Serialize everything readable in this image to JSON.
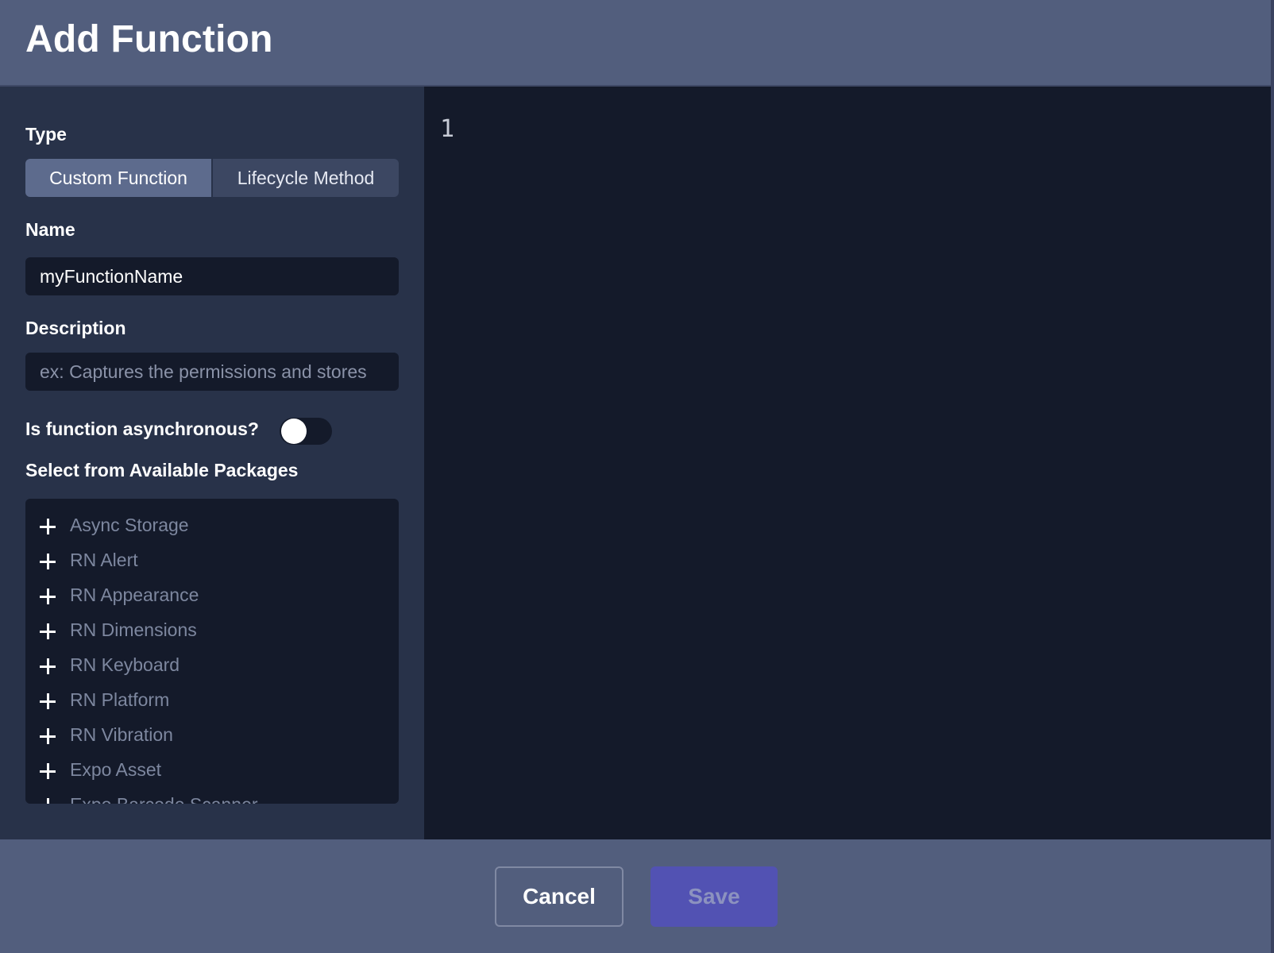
{
  "header": {
    "title": "Add Function"
  },
  "form": {
    "type": {
      "label": "Type",
      "options": [
        "Custom Function",
        "Lifecycle Method"
      ],
      "selected": "Custom Function"
    },
    "name": {
      "label": "Name",
      "value": "myFunctionName"
    },
    "description": {
      "label": "Description",
      "placeholder": "ex: Captures the permissions and stores"
    },
    "async": {
      "label": "Is function asynchronous?",
      "enabled": false
    },
    "packages": {
      "label": "Select from Available Packages",
      "items": [
        "Async Storage",
        "RN Alert",
        "RN Appearance",
        "RN Dimensions",
        "RN Keyboard",
        "RN Platform",
        "RN Vibration",
        "Expo Asset",
        "Expo Barcode Scanner"
      ]
    }
  },
  "editor": {
    "line_numbers": [
      "1"
    ]
  },
  "footer": {
    "cancel_label": "Cancel",
    "save_label": "Save"
  },
  "colors": {
    "header_bg": "#525e7d",
    "panel_bg": "#283249",
    "input_bg": "#141a2a",
    "save_button": "#5252b3"
  },
  "icons": {
    "package_add": "plus-icon"
  }
}
